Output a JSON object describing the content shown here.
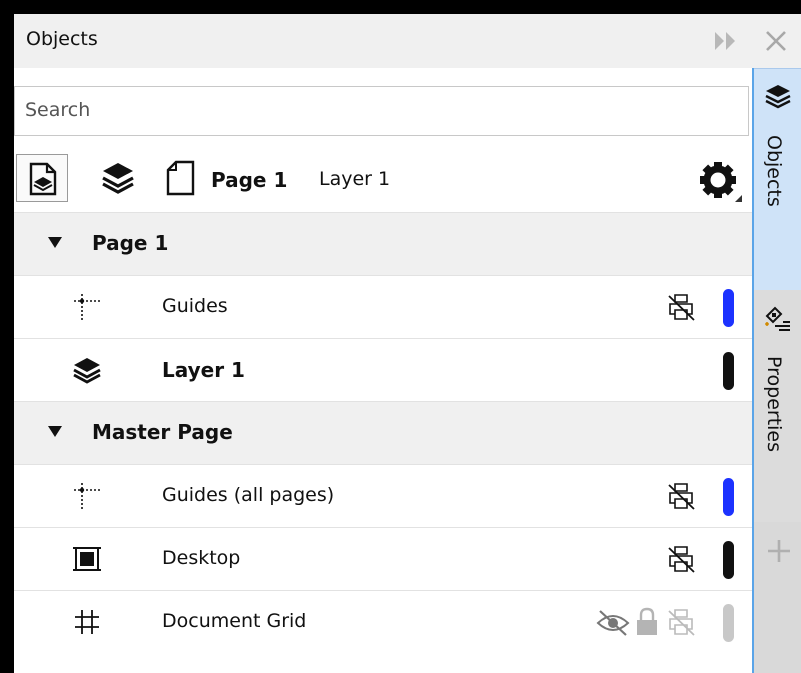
{
  "panel": {
    "title": "Objects"
  },
  "search": {
    "placeholder": "Search"
  },
  "toolbar": {
    "page_label": "Page 1",
    "layer_label": "Layer 1"
  },
  "tree": {
    "page1": {
      "label": "Page 1",
      "items": [
        {
          "label": "Guides",
          "icon": "guides-icon",
          "bar_color": "#1c32ff"
        },
        {
          "label": "Layer 1",
          "icon": "layers-icon",
          "bar_color": "#111111"
        }
      ]
    },
    "master": {
      "label": "Master Page",
      "items": [
        {
          "label": "Guides (all pages)",
          "icon": "guides-icon",
          "bar_color": "#1c32ff"
        },
        {
          "label": "Desktop",
          "icon": "desktop-icon",
          "bar_color": "#111111"
        },
        {
          "label": "Document Grid",
          "icon": "grid-icon",
          "bar_color": "#c8c8c8"
        }
      ]
    }
  },
  "dock": {
    "objects_label": "Objects",
    "properties_label": "Properties"
  },
  "colors": {
    "accent": "#5aa4e8",
    "active_tab": "#cfe3f8",
    "guide_blue": "#1c32ff"
  }
}
